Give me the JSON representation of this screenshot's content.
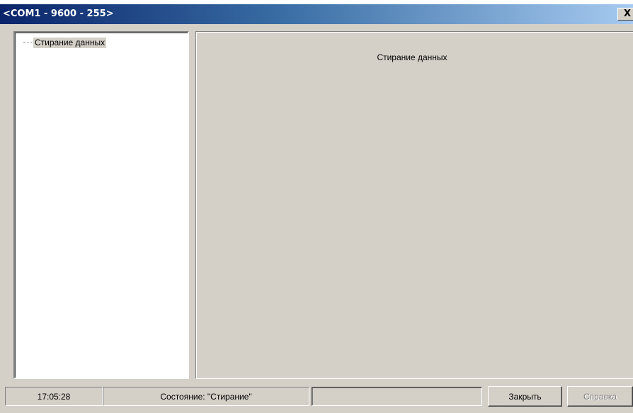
{
  "window": {
    "title": "<COM1 - 9600 - 255>",
    "close_glyph": "X"
  },
  "tree": {
    "items": [
      {
        "label": "Стирание данных",
        "selected": true
      }
    ]
  },
  "content": {
    "title": "Стирание данных"
  },
  "status": {
    "time": "17:05:28",
    "state": "Состояние: \"Стирание\"",
    "progress": 0
  },
  "buttons": {
    "close_label": "Закрыть",
    "help_label": "Справка",
    "help_enabled": false
  },
  "colors": {
    "face": "#d4d0c8",
    "title_start": "#0a246a",
    "title_end": "#a6caf0"
  }
}
